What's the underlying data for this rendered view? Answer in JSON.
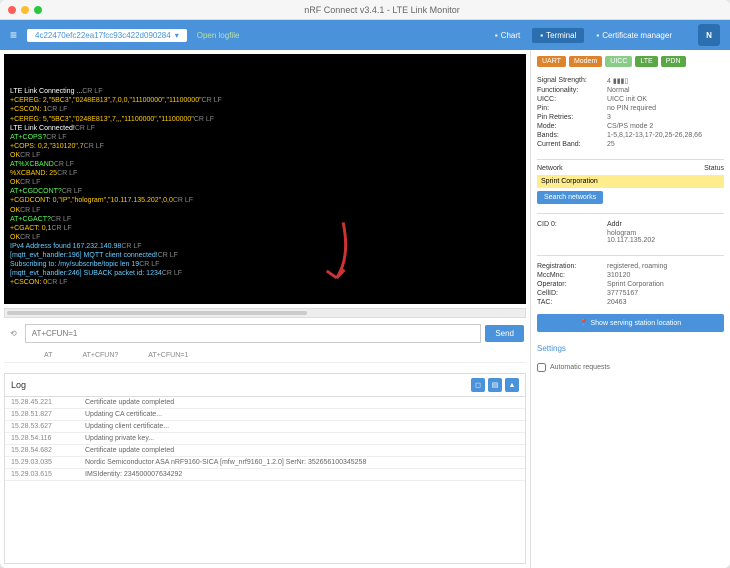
{
  "title": "nRF Connect v3.4.1 - LTE Link Monitor",
  "device": "4c22470efc22ea17fcc93c422d090284",
  "tabs": {
    "chart": "Chart",
    "terminal": "Terminal",
    "cert": "Certificate manager"
  },
  "terminal": [
    {
      "c": "w",
      "t": "LTE Link Connecting ..."
    },
    {
      "c": "gy",
      "t": "CR LF"
    },
    {
      "c": "y",
      "t": "+CEREG: 2,\"5BC3\",\"0248E813\",7,0,0,\"11100000\",\"11100000\""
    },
    {
      "c": "gy",
      "t": "CR LF"
    },
    {
      "c": "y",
      "t": "+CSCON: 1"
    },
    {
      "c": "gy",
      "t": "CR LF"
    },
    {
      "c": "y",
      "t": "+CEREG: 5,\"5BC3\",\"0248E813\",7,,,\"11100000\",\"11100000\""
    },
    {
      "c": "gy",
      "t": "CR LF"
    },
    {
      "c": "w",
      "t": "LTE Link Connected!"
    },
    {
      "c": "gy",
      "t": "CR LF"
    },
    {
      "c": "g",
      "t": "AT+COPS?"
    },
    {
      "c": "gy",
      "t": "CR LF"
    },
    {
      "c": "y",
      "t": "+COPS: 0,2,\"310120\",7"
    },
    {
      "c": "gy",
      "t": "CR LF"
    },
    {
      "c": "y",
      "t": "OK"
    },
    {
      "c": "gy",
      "t": "CR LF"
    },
    {
      "c": "g",
      "t": "AT%XCBAND"
    },
    {
      "c": "gy",
      "t": "CR LF"
    },
    {
      "c": "y",
      "t": "%XCBAND: 25"
    },
    {
      "c": "gy",
      "t": "CR LF"
    },
    {
      "c": "y",
      "t": "OK"
    },
    {
      "c": "gy",
      "t": "CR LF"
    },
    {
      "c": "g",
      "t": "AT+CGDCONT?"
    },
    {
      "c": "gy",
      "t": "CR LF"
    },
    {
      "c": "y",
      "t": "+CGDCONT: 0,\"IP\",\"hologram\",\"10.117.135.202\",0,0"
    },
    {
      "c": "gy",
      "t": "CR LF"
    },
    {
      "c": "y",
      "t": "OK"
    },
    {
      "c": "gy",
      "t": "CR LF"
    },
    {
      "c": "g",
      "t": "AT+CGACT?"
    },
    {
      "c": "gy",
      "t": "CR LF"
    },
    {
      "c": "y",
      "t": "+CGACT: 0,1"
    },
    {
      "c": "gy",
      "t": "CR LF"
    },
    {
      "c": "y",
      "t": "OK"
    },
    {
      "c": "gy",
      "t": "CR LF"
    },
    {
      "c": "c",
      "t": "IPv4 Address found 167.232.140.98"
    },
    {
      "c": "gy",
      "t": "CR LF"
    },
    {
      "c": "c",
      "t": "[mqtt_evt_handler:196] MQTT client connected!"
    },
    {
      "c": "gy",
      "t": "CR LF"
    },
    {
      "c": "c",
      "t": "Subscribing to: /my/subscribe/topic len 19"
    },
    {
      "c": "gy",
      "t": "CR LF"
    },
    {
      "c": "c",
      "t": "[mqtt_evt_handler:246] SUBACK packet id: 1234"
    },
    {
      "c": "gy",
      "t": "CR LF"
    },
    {
      "c": "y",
      "t": "+CSCON: 0"
    },
    {
      "c": "gy",
      "t": "CR LF"
    }
  ],
  "cmd_placeholder": "AT+CFUN=1",
  "send_label": "Send",
  "history": [
    "AT",
    "AT+CFUN?",
    "AT+CFUN=1"
  ],
  "log_label": "Log",
  "log": [
    {
      "ts": "15.28.45.221",
      "m": "Certificate update completed"
    },
    {
      "ts": "15.28.51.827",
      "m": "Updating CA certificate..."
    },
    {
      "ts": "15.28.53.627",
      "m": "Updating client certificate..."
    },
    {
      "ts": "15.28.54.116",
      "m": "Updating private key..."
    },
    {
      "ts": "15.28.54.682",
      "m": "Certificate update completed"
    },
    {
      "ts": "15.29.03.035",
      "m": "Nordic Semiconductor ASA nRF9160-SICA [mfw_nrf9160_1.2.0] SerNr: 352656100345258"
    },
    {
      "ts": "15.29.03.615",
      "m": "IMSIdentity: 234500007634292"
    }
  ],
  "badges": [
    {
      "l": "UART",
      "c": "b-r"
    },
    {
      "l": "Modem",
      "c": "b-r"
    },
    {
      "l": "UICC",
      "c": "b-og"
    },
    {
      "l": "LTE",
      "c": "b-g"
    },
    {
      "l": "PDN",
      "c": "b-g"
    }
  ],
  "status": {
    "signal": {
      "k": "Signal Strength:",
      "v": "4 ▮▮▮▯"
    },
    "func": {
      "k": "Functionality:",
      "v": "Normal"
    },
    "uicc": {
      "k": "UICC:",
      "v": "UICC init OK"
    },
    "pin": {
      "k": "Pin:",
      "v": "no PIN required"
    },
    "retries": {
      "k": "Pin Retries:",
      "v": "3"
    },
    "mode": {
      "k": "Mode:",
      "v": "CS/PS mode 2"
    },
    "bands": {
      "k": "Bands:",
      "v": "1-5,8,12-13,17-20,25-26,28,66"
    },
    "curband": {
      "k": "Current Band:",
      "v": "25"
    }
  },
  "net_label": "Network",
  "net_status": "Status",
  "net_name": "Sprint Corporation",
  "search_label": "Search networks",
  "cid": {
    "k": "CID 0:",
    "addr_k": "Addr",
    "addr": "hologram\n10.117.135.202"
  },
  "reg": {
    "k": "Registration:",
    "v": "registered, roaming"
  },
  "mcc": {
    "k": "MccMnc:",
    "v": "310120"
  },
  "op": {
    "k": "Operator:",
    "v": "Sprint Corporation"
  },
  "cell": {
    "k": "CellID:",
    "v": "37775167"
  },
  "tac": {
    "k": "TAC:",
    "v": "20463"
  },
  "loc_btn": "Show serving station location",
  "settings": "Settings",
  "auto_req": "Automatic requests",
  "open_log": "Open logfile"
}
